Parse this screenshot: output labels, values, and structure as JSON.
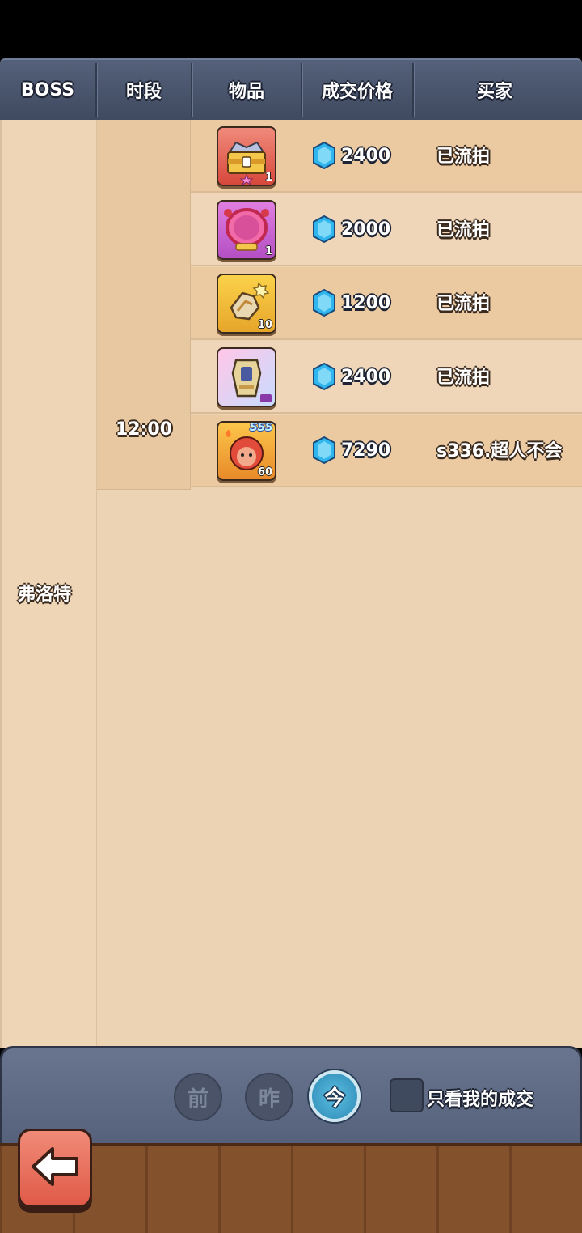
{
  "header": {
    "boss": "BOSS",
    "period": "时段",
    "item": "物品",
    "price": "成交价格",
    "buyer": "买家"
  },
  "boss_name": "弗洛特",
  "time_slot": "12:00",
  "rows": [
    {
      "item_icon": "treasure-chest-icon",
      "item_qty": "1",
      "price": "2400",
      "buyer": "已流拍"
    },
    {
      "item_icon": "pink-frame-icon",
      "item_qty": "1",
      "price": "2000",
      "buyer": "已流拍"
    },
    {
      "item_icon": "golden-gauntlet-icon",
      "item_qty": "10",
      "price": "1200",
      "buyer": "已流拍"
    },
    {
      "item_icon": "armor-piece-icon",
      "item_qty": "",
      "price": "2400",
      "buyer": "已流拍"
    },
    {
      "item_icon": "hero-portrait-icon",
      "item_qty": "60",
      "item_rank": "SSS",
      "price": "7290",
      "buyer": "s336.超人不会"
    }
  ],
  "filters": {
    "day_before": "前",
    "yesterday": "昨",
    "today": "今",
    "selected": "今",
    "only_mine_label": "只看我的成交",
    "only_mine_checked": false
  },
  "colors": {
    "gem": "#2fb6ee",
    "header_bg": "#4a556d",
    "table_bg": "#ecd3b3",
    "back_button": "#e8685a"
  }
}
